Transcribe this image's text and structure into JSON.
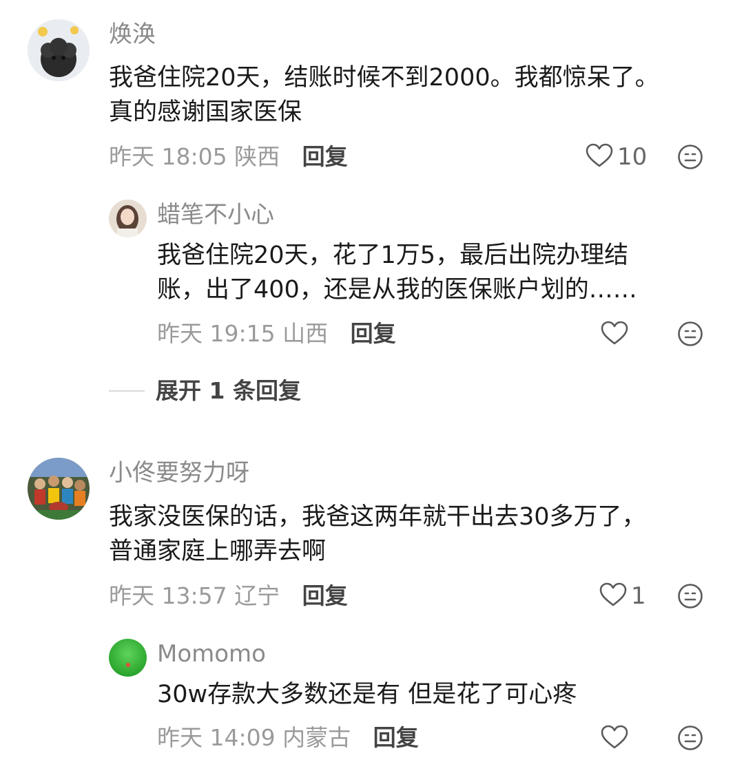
{
  "comments": [
    {
      "username": "焕涣",
      "text": "我爸住院20天，结账时候不到2000。我都惊呆了。\n真的感谢国家医保",
      "time": "昨天 18:05",
      "location": "陕西",
      "reply_label": "回复",
      "likes": "10",
      "replies": [
        {
          "username": "蜡笔不小心",
          "text": "我爸住院20天，花了1万5，最后出院办理结\n账，出了400，还是从我的医保账户划的……",
          "time": "昨天 19:15",
          "location": "山西",
          "reply_label": "回复",
          "likes": ""
        }
      ],
      "expand_label": "展开 1 条回复"
    },
    {
      "username": "小佟要努力呀",
      "text": "我家没医保的话，我爸这两年就干出去30多万了，\n普通家庭上哪弄去啊",
      "time": "昨天 13:57",
      "location": "辽宁",
      "reply_label": "回复",
      "likes": "1",
      "replies": [
        {
          "username": "Momomo",
          "text": "30w存款大多数还是有 但是花了可心疼",
          "time": "昨天 14:09",
          "location": "内蒙古",
          "reply_label": "回复",
          "likes": ""
        }
      ]
    }
  ],
  "icons": {
    "like": "heart-outline-icon",
    "emoji": "neutral-face-icon"
  },
  "colors": {
    "username": "#8a8a8a",
    "meta": "#9a9a9a",
    "reply": "#444444",
    "icon": "#5a5a5a"
  }
}
